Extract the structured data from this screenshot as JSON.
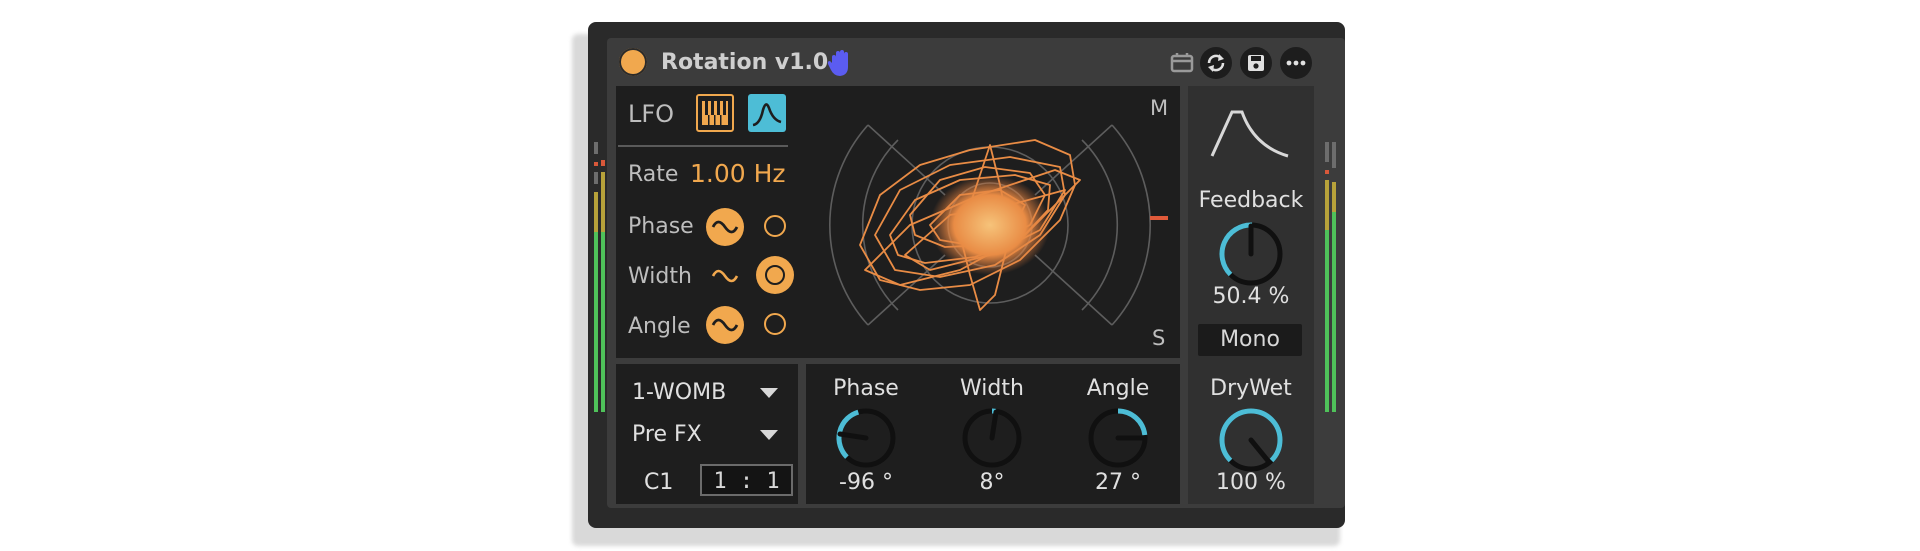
{
  "device": {
    "title": "Rotation v1.0"
  },
  "lfo": {
    "label": "LFO",
    "rate_label": "Rate",
    "rate_value": "1.00 Hz",
    "phase_label": "Phase",
    "width_label": "Width",
    "angle_label": "Angle"
  },
  "scope": {
    "mid_label": "M",
    "side_label": "S"
  },
  "routing": {
    "source": "1-WOMB",
    "tap": "Pre FX",
    "channel": "C1",
    "ratio": "1 : 1"
  },
  "knobs": [
    {
      "label": "Phase",
      "value": "-96 °"
    },
    {
      "label": "Width",
      "value": "8°"
    },
    {
      "label": "Angle",
      "value": "27 °"
    }
  ],
  "right": {
    "feedback_label": "Feedback",
    "feedback_value": "50.4 %",
    "mono_label": "Mono",
    "drywet_label": "DryWet",
    "drywet_value": "100 %"
  },
  "colors": {
    "accent_orange": "#f1a84e",
    "accent_cyan": "#4dbdd6",
    "meter_green": "#4fc25a",
    "meter_yellow": "#b7a23a"
  }
}
